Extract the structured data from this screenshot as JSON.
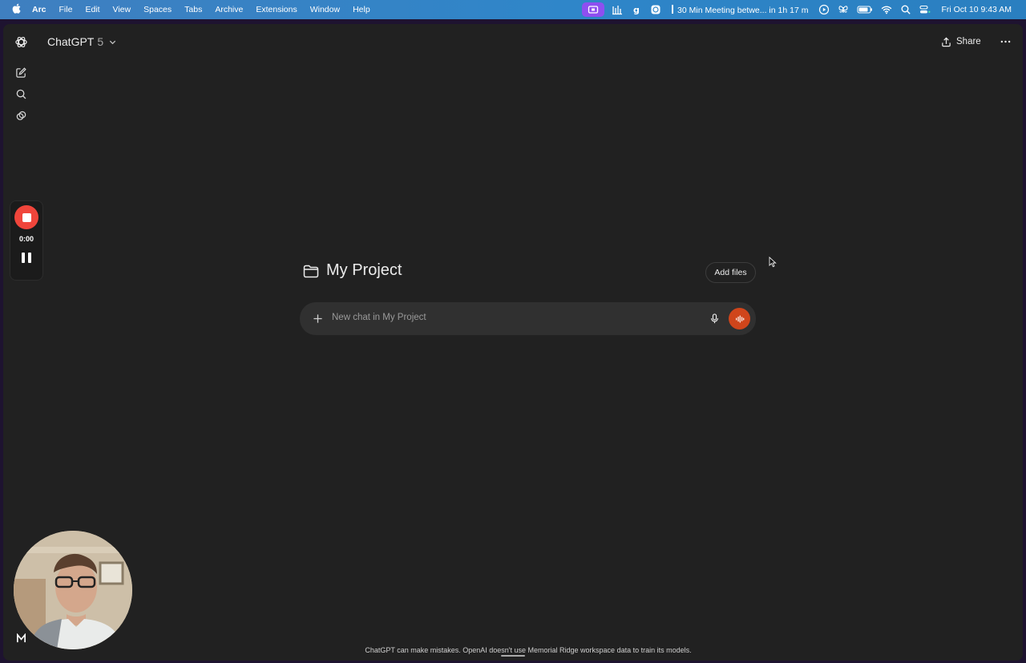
{
  "menubar": {
    "app_name": "Arc",
    "menus": [
      "File",
      "Edit",
      "View",
      "Spaces",
      "Tabs",
      "Archive",
      "Extensions",
      "Window",
      "Help"
    ],
    "meeting": "30 Min Meeting betwe... in 1h 17 m",
    "clock": "Fri Oct 10  9:43 AM",
    "status_icons": [
      "screen-record-icon",
      "audio-bars-icon",
      "grammarly-icon",
      "chatgpt-status-icon",
      "meeting-bar-icon",
      "play-icon",
      "butterfly-icon",
      "battery-icon",
      "wifi-icon",
      "spotlight-icon",
      "control-center-icon"
    ]
  },
  "app": {
    "title": "ChatGPT",
    "version": "5",
    "share_label": "Share"
  },
  "project": {
    "name": "My Project",
    "add_files_label": "Add files",
    "composer_placeholder": "New chat in My Project"
  },
  "recorder": {
    "elapsed": "0:00"
  },
  "footer": {
    "disclaimer": "ChatGPT can make mistakes. OpenAI doesn't use Memorial Ridge workspace data to train its models."
  },
  "colors": {
    "window_bg": "#212121",
    "composer_bg": "#303030",
    "voice_button": "#d0451b",
    "record_button": "#f0453b",
    "menubar": "#2f86c9"
  }
}
